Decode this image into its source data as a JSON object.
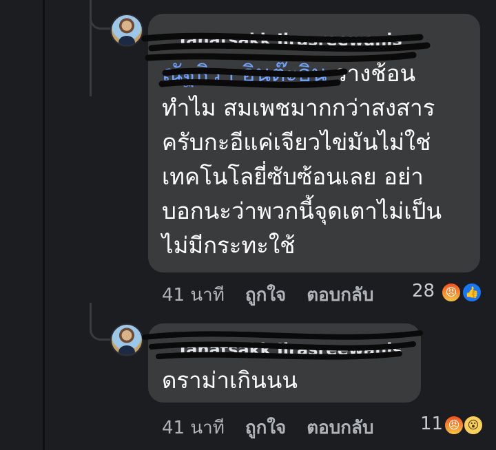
{
  "colors": {
    "background": "#1c1d20",
    "bubble": "#3a3b3c",
    "mention": "#6fa3ff",
    "meta": "#b0b3b8"
  },
  "comments": [
    {
      "author": "Tanatsakk Jirasreewanis",
      "mention": "ณัฐธิรา อินต๊ะอิน",
      "lines": [
        "วางช้อน",
        "ทำไม สมเพชมากกว่าสงสาร",
        "ครับกะอีแค่เจียวไข่มันไม่ใช่",
        "เทคโนโลยี่ซับซ้อนเลย อย่า",
        "บอกนะว่าพวกนี้จุดเตาไม่เป็น",
        "ไม่มีกระทะใช้"
      ],
      "time": "41 นาที",
      "like_label": "ถูกใจ",
      "reply_label": "ตอบกลับ",
      "reaction_count": "28",
      "reactions": [
        "angry-reaction-icon",
        "like-reaction-icon"
      ]
    },
    {
      "author": "Tanatsakk Jirasreewanis",
      "lines": [
        "ดราม่าเกินนน"
      ],
      "time": "41 นาที",
      "like_label": "ถูกใจ",
      "reply_label": "ตอบกลับ",
      "reaction_count": "11",
      "reactions": [
        "angry-reaction-icon",
        "wow-reaction-icon"
      ]
    }
  ]
}
